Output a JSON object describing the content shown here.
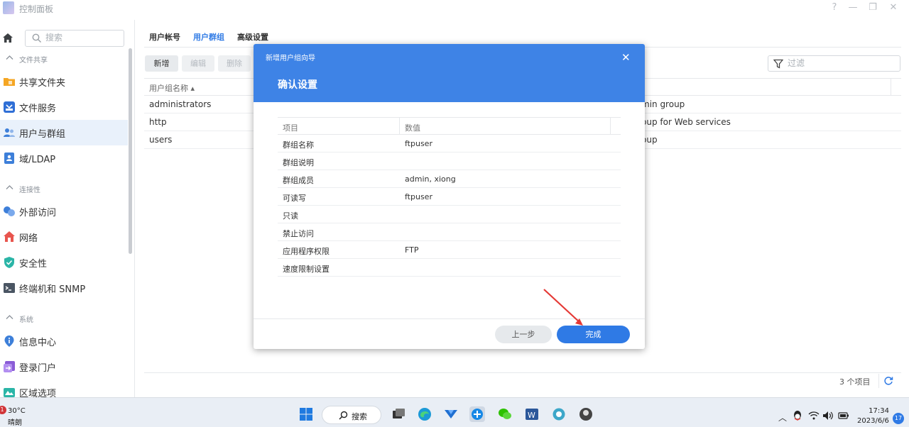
{
  "window": {
    "title": "控制面板",
    "controls": [
      "?",
      "—",
      "❐",
      "✕"
    ]
  },
  "sidebar": {
    "search_placeholder": "搜索",
    "sections": [
      {
        "label": "文件共享",
        "items": [
          "共享文件夹",
          "文件服务",
          "用户与群组",
          "域/LDAP"
        ]
      },
      {
        "label": "连接性",
        "items": [
          "外部访问",
          "网络",
          "安全性",
          "终端机和 SNMP"
        ]
      },
      {
        "label": "系统",
        "items": [
          "信息中心",
          "登录门户",
          "区域选项"
        ]
      }
    ],
    "active_item": "用户与群组"
  },
  "main": {
    "tabs": [
      "用户帐号",
      "用户群组",
      "高级设置"
    ],
    "active_tab": "用户群组",
    "toolbar": {
      "add": "新增",
      "edit": "编辑",
      "delete": "删除"
    },
    "filter_placeholder": "过滤",
    "table": {
      "header": "用户组名称 ▴",
      "rows": [
        {
          "name": "administrators",
          "desc": "min group"
        },
        {
          "name": "http",
          "desc": "oup for Web services"
        },
        {
          "name": "users",
          "desc": "oup"
        }
      ]
    },
    "count": "3 个项目"
  },
  "dialog": {
    "subtitle": "新增用户组向导",
    "title": "确认设置",
    "table": {
      "col_item": "项目",
      "col_value": "数值",
      "rows": [
        {
          "item": "群组名称",
          "value": "ftpuser"
        },
        {
          "item": "群组说明",
          "value": ""
        },
        {
          "item": "群组成员",
          "value": "admin, xiong"
        },
        {
          "item": "可读写",
          "value": "ftpuser"
        },
        {
          "item": "只读",
          "value": ""
        },
        {
          "item": "禁止访问",
          "value": ""
        },
        {
          "item": "应用程序权限",
          "value": "FTP"
        },
        {
          "item": "速度限制设置",
          "value": ""
        }
      ]
    },
    "buttons": {
      "prev": "上一步",
      "done": "完成"
    }
  },
  "taskbar": {
    "weather_badge": "1",
    "temperature": "30°C",
    "weather": "晴朗",
    "search_label": "搜索",
    "time": "17:34",
    "date": "2023/6/6",
    "notifications": "17"
  },
  "colors": {
    "accent": "#2f7ae5",
    "dialog_header": "#3e83e6",
    "arrow": "#e53935"
  }
}
